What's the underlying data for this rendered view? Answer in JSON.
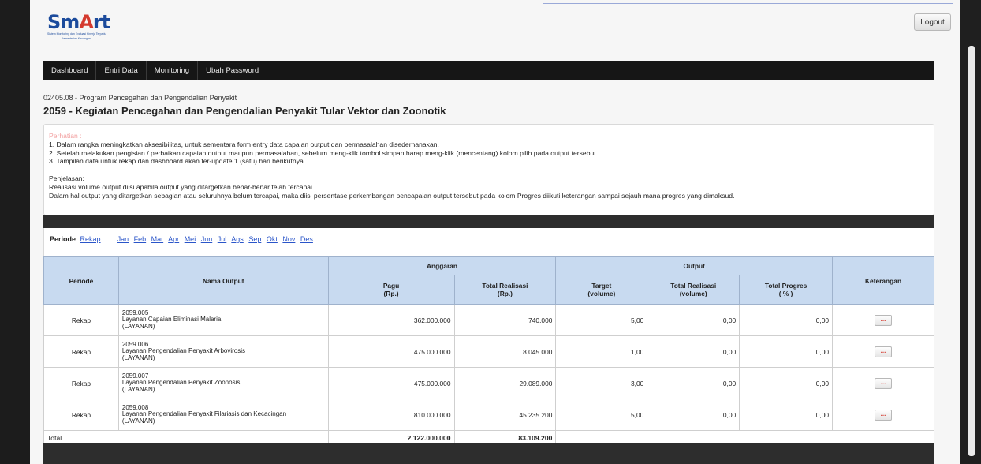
{
  "logo": {
    "word": "SmArt",
    "sub1": "Sistem Monitoring dan Evaluasi Kinerja Terpadu",
    "sub2": "Kementerian Keuangan"
  },
  "logout_label": "Logout",
  "nav": [
    "Dashboard",
    "Entri Data",
    "Monitoring",
    "Ubah Password"
  ],
  "program": "02405.08 - Program Pencegahan dan Pengendalian Penyakit",
  "kegiatan": "2059 - Kegiatan Pencegahan dan Pengendalian Penyakit Tular Vektor dan Zoonotik",
  "notice": {
    "attention": "Perhatian :",
    "lines": [
      "1. Dalam rangka meningkatkan aksesibilitas, untuk sementara form entry data capaian output dan permasalahan disederhanakan.",
      "2. Setelah melakukan pengisian / perbaikan capaian output maupun permasalahan, sebelum meng-klik tombol simpan harap meng-klik (mencentang) kolom pilih pada output tersebut.",
      "3. Tampilan data untuk rekap dan dashboard akan ter-update 1 (satu) hari berikutnya."
    ],
    "penjelasan_title": "Penjelasan:",
    "penjelasan": [
      "Realisasi volume output diisi apabila output yang ditargetkan benar-benar telah tercapai.",
      "Dalam hal output yang ditargetkan sebagian atau seluruhnya belum tercapai, maka diisi persentase perkembangan pencapaian output tersebut pada kolom Progres diikuti keterangan sampai sejauh mana progres yang dimaksud."
    ]
  },
  "periode": {
    "label": "Periode",
    "rekap": "Rekap",
    "months": [
      "Jan",
      "Feb",
      "Mar",
      "Apr",
      "Mei",
      "Jun",
      "Jul",
      "Ags",
      "Sep",
      "Okt",
      "Nov",
      "Des"
    ]
  },
  "table": {
    "h_periode": "Periode",
    "h_nama": "Nama Output",
    "h_anggaran": "Anggaran",
    "h_output": "Output",
    "h_ket": "Keterangan",
    "h_pagu": "Pagu",
    "h_pagu_unit": "(Rp.)",
    "h_tr": "Total Realisasi",
    "h_tr_unit": "(Rp.)",
    "h_target": "Target",
    "h_target_unit": "(volume)",
    "h_trv": "Total Realisasi",
    "h_trv_unit": "(volume)",
    "h_tp": "Total Progres",
    "h_tp_unit": "( % )",
    "rows": [
      {
        "periode": "Rekap",
        "code": "2059.005",
        "name": "Layanan Capaian Eliminasi Malaria",
        "type": "(LAYANAN)",
        "pagu": "362.000.000",
        "realisasi": "740.000",
        "target": "5,00",
        "realisasi_vol": "0,00",
        "progres": "0,00",
        "ket": "..."
      },
      {
        "periode": "Rekap",
        "code": "2059.006",
        "name": "Layanan Pengendalian Penyakit Arbovirosis",
        "type": "(LAYANAN)",
        "pagu": "475.000.000",
        "realisasi": "8.045.000",
        "target": "1,00",
        "realisasi_vol": "0,00",
        "progres": "0,00",
        "ket": "..."
      },
      {
        "periode": "Rekap",
        "code": "2059.007",
        "name": "Layanan Pengendalian Penyakit Zoonosis",
        "type": "(LAYANAN)",
        "pagu": "475.000.000",
        "realisasi": "29.089.000",
        "target": "3,00",
        "realisasi_vol": "0,00",
        "progres": "0,00",
        "ket": "..."
      },
      {
        "periode": "Rekap",
        "code": "2059.008",
        "name": "Layanan Pengendalian Penyakit Filariasis dan Kecacingan",
        "type": "(LAYANAN)",
        "pagu": "810.000.000",
        "realisasi": "45.235.200",
        "target": "5,00",
        "realisasi_vol": "0,00",
        "progres": "0,00",
        "ket": "..."
      }
    ],
    "total_label": "Total",
    "total_pagu": "2.122.000.000",
    "total_realisasi": "83.109.200"
  }
}
